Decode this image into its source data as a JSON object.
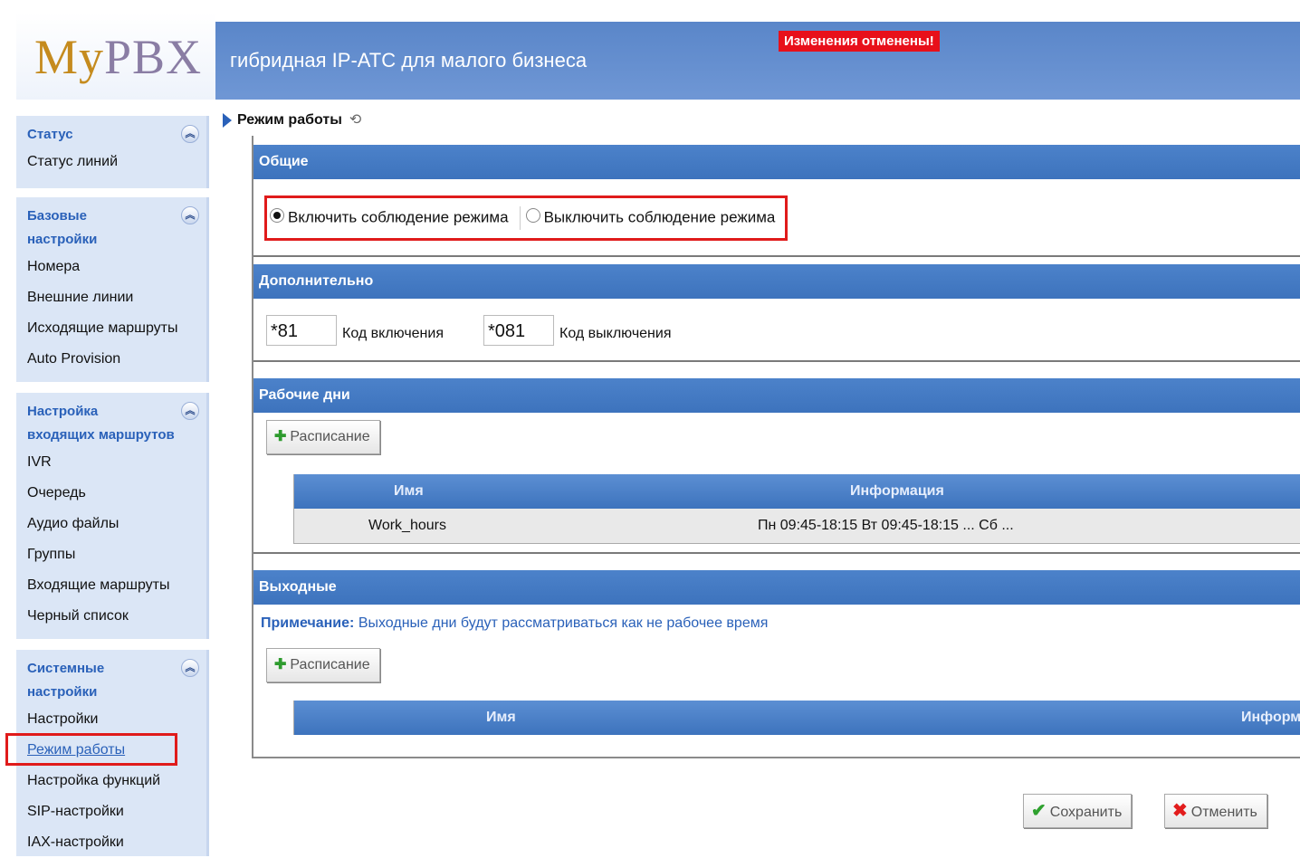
{
  "header": {
    "logo_my": "My",
    "logo_pbx": "PBX",
    "tagline": "гибридная IP-АТС для малого бизнеса",
    "alert": "Изменения отменены!"
  },
  "sidebar": {
    "groups": [
      {
        "title_l1": "Статус",
        "title_l2": "",
        "items": [
          "Статус линий"
        ]
      },
      {
        "title_l1": "Базовые",
        "title_l2": "настройки",
        "items": [
          "Номера",
          "Внешние линии",
          "Исходящие маршруты",
          "Auto Provision"
        ]
      },
      {
        "title_l1": "Настройка",
        "title_l2": "входящих маршрутов",
        "items": [
          "IVR",
          "Очередь",
          "Аудио файлы",
          "Группы",
          "Входящие маршруты",
          "Черный список"
        ]
      },
      {
        "title_l1": "Системные",
        "title_l2": "настройки",
        "items": [
          "Настройки",
          "Режим работы",
          "Настройка функций",
          "SIP-настройки",
          "IAX-настройки"
        ]
      }
    ],
    "active_item": "Режим работы"
  },
  "breadcrumb": {
    "title": "Режим работы"
  },
  "sections": {
    "general": {
      "title": "Общие",
      "radio_on_label": "Включить соблюдение режима",
      "radio_off_label": "Выключить соблюдение режима",
      "selected": "on"
    },
    "additional": {
      "title": "Дополнительно",
      "on_code_value": "*81",
      "on_code_label": "Код включения",
      "off_code_value": "*081",
      "off_code_label": "Код выключения"
    },
    "workdays": {
      "title": "Рабочие дни",
      "add_button": "Расписание",
      "columns": [
        "Имя",
        "Информация"
      ],
      "rows": [
        {
          "name": "Work_hours",
          "info": "Пн 09:45-18:15  Вт 09:45-18:15 ... Сб ..."
        }
      ]
    },
    "holidays": {
      "title": "Выходные",
      "note_label": "Примечание:",
      "note_text": "Выходные дни будут рассматриваться как не рабочее время",
      "add_button": "Расписание",
      "columns": [
        "Имя",
        "Информа"
      ]
    }
  },
  "footer": {
    "save_label": "Сохранить",
    "cancel_label": "Отменить"
  }
}
